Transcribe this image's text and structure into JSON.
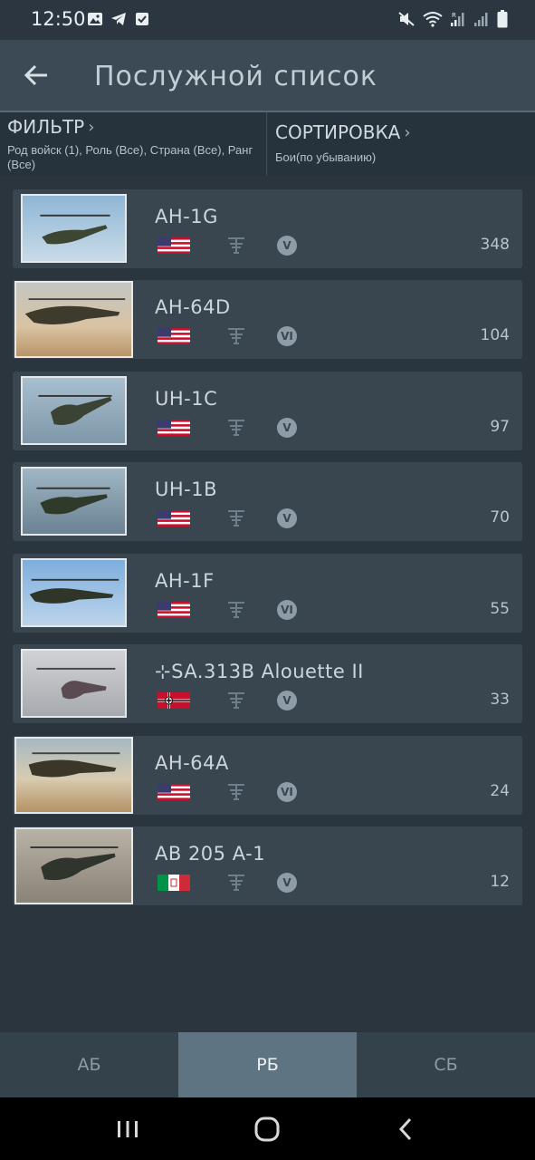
{
  "status_bar": {
    "time": "12:50",
    "left_icons": [
      "gallery-icon",
      "telegram-icon",
      "checkbox-icon"
    ],
    "right_icons": [
      "mute-icon",
      "wifi-icon",
      "signal-icon",
      "signal-icon",
      "battery-icon"
    ]
  },
  "app_bar": {
    "title": "Послужной список",
    "back_icon": "arrow-left-icon"
  },
  "filter": {
    "label": "ФИЛЬТР",
    "summary": "Род войск (1), Роль (Все), Страна (Все), Ранг (Все)"
  },
  "sort": {
    "label": "СОРТИРОВКА",
    "summary": "Бои(по убыванию)"
  },
  "vehicles": [
    {
      "name": "AH-1G",
      "country": "usa",
      "rank": "V",
      "battles": "348"
    },
    {
      "name": "AH-64D",
      "country": "usa",
      "rank": "VI",
      "battles": "104"
    },
    {
      "name": "UH-1C",
      "country": "usa",
      "rank": "V",
      "battles": "97"
    },
    {
      "name": "UH-1B",
      "country": "usa",
      "rank": "V",
      "battles": "70"
    },
    {
      "name": "AH-1F",
      "country": "usa",
      "rank": "VI",
      "battles": "55"
    },
    {
      "name": "⊹SA.313B Alouette II",
      "country": "germany",
      "rank": "V",
      "battles": "33"
    },
    {
      "name": "AH-64A",
      "country": "usa",
      "rank": "VI",
      "battles": "24"
    },
    {
      "name": "AB 205 A-1",
      "country": "italy",
      "rank": "V",
      "battles": "12"
    }
  ],
  "tabs": [
    {
      "label": "АБ",
      "active": false
    },
    {
      "label": "РБ",
      "active": true
    },
    {
      "label": "СБ",
      "active": false
    }
  ],
  "nav_icons": [
    "recents-icon",
    "home-icon",
    "back-icon"
  ],
  "colors": {
    "background": "#2b353d",
    "card": "#394650",
    "app_bar": "#3b4a55",
    "active_tab": "#5f7483"
  }
}
